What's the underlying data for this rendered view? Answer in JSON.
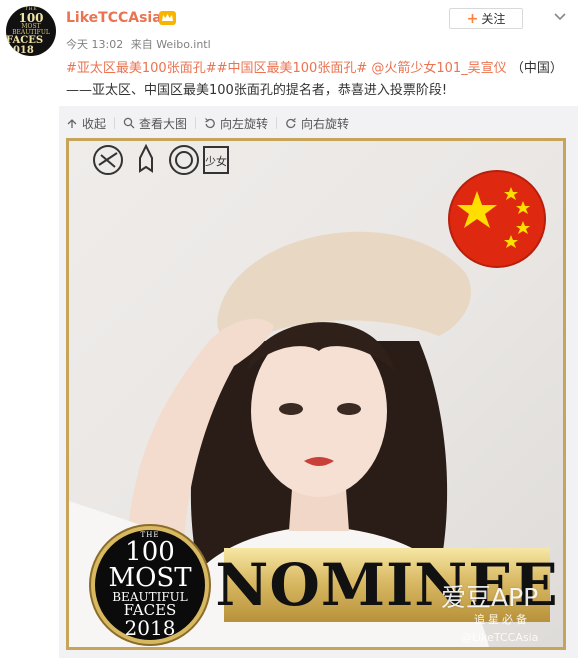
{
  "header": {
    "username": "LikeTCCAsia",
    "time": "今天 13:02",
    "source_prefix": "来自",
    "source": "Weibo.intl",
    "follow_label": "关注",
    "avatar_lines": [
      "THE",
      "100",
      "MOST",
      "BEAUTIFUL",
      "FACES 2018"
    ]
  },
  "post": {
    "hashtag1": "#亚太区最美100张面孔#",
    "hashtag2": "#中国区最美100张面孔#",
    "mention": "@火箭少女101_吴宣仪",
    "text_rest": "（中国）——亚太区、中国区最美100张面孔的提名者，恭喜进入投票阶段!"
  },
  "toolbar": {
    "collapse": "收起",
    "view_large": "查看大图",
    "rotate_left": "向左旋转",
    "rotate_right": "向右旋转"
  },
  "image": {
    "nominee_text": "NOMINEE",
    "badge_lines": [
      "THE",
      "100",
      "MOST",
      "BEAUTIFUL",
      "FACES",
      "2018"
    ],
    "watermark_app": "爱豆APP",
    "watermark_slogan": "追星必备",
    "watermark_weibo": "@LikeTCCAsia",
    "brand_text": "少女"
  },
  "colors": {
    "link": "#eb7350",
    "gold": "#c6a55a",
    "flag_red": "#de2910",
    "flag_star": "#ffde00"
  },
  "icons": [
    "vip-crown-icon",
    "chevron-down-icon",
    "collapse-icon",
    "magnifier-icon",
    "rotate-left-icon",
    "rotate-right-icon",
    "china-flag-icon"
  ]
}
